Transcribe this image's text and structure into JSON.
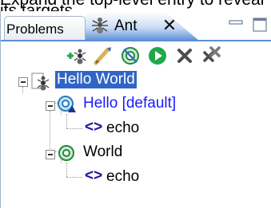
{
  "caption": "Expand the top-level entry to reveal its targets.",
  "tabs": {
    "problems": "Problems",
    "ant": "Ant",
    "close_glyph": "✕"
  },
  "toolbar": {
    "buttons": [
      "add-buildfiles-icon",
      "add-with-search-icon",
      "hide-internal-targets-icon",
      "run-icon",
      "remove-icon",
      "remove-all-icon"
    ]
  },
  "tree": {
    "project": "Hello World",
    "targets": [
      {
        "name": "Hello [default]",
        "task": "echo"
      },
      {
        "name": "World",
        "task": "echo"
      }
    ]
  },
  "colors": {
    "selection": "#3165c5",
    "default_target": "#1a1aff",
    "tab_accent": "#5d8fd6",
    "run_green": "#1fa84a"
  }
}
